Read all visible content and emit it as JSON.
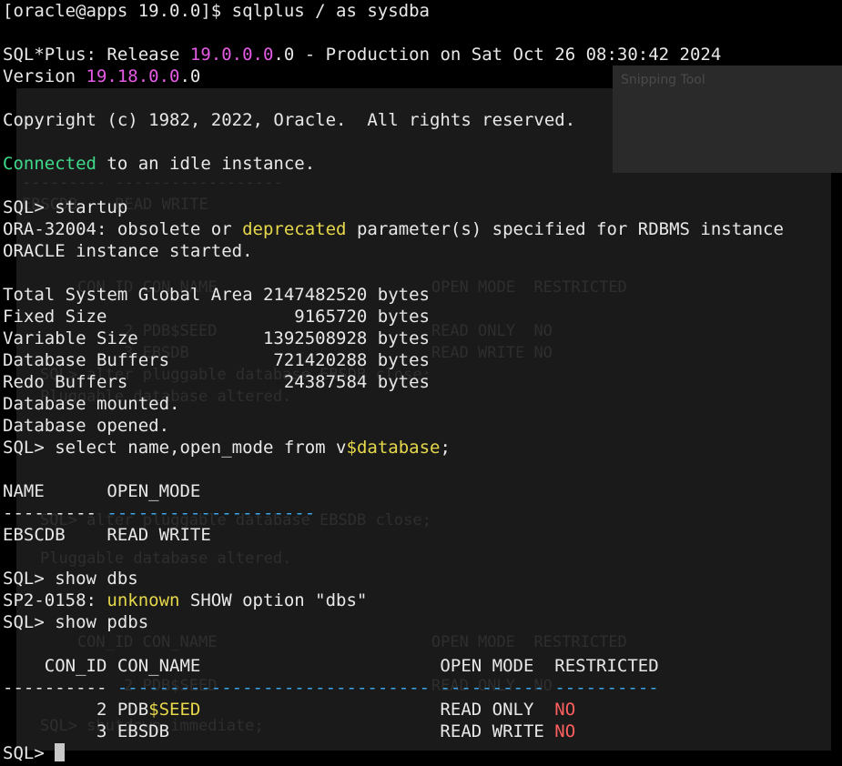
{
  "window": {
    "ghost_title": "Snipping Tool",
    "ghost_lines": [
      "--------- ------------------",
      "EBSCDB    READ WRITE",
      "    CON_ID CON_NAME                       OPEN MODE  RESTRICTED",
      "         2 PDB$SEED                       READ ONLY  NO",
      "         3 EBSDB                          READ WRITE NO",
      "SQL> alter pluggable database EBSDB close;",
      "Pluggable database altered.",
      "SQL> alter pluggable database EBSDB close;",
      "Pluggable database altered.",
      "    CON_ID CON_NAME                       OPEN MODE  RESTRICTED",
      "         2 PDB$SEED                       READ ONLY  NO",
      "SQL> shutdown immediate;"
    ]
  },
  "colors": {
    "background": "#000000",
    "text": "#e8e8e8",
    "magenta": "#e65be6",
    "green": "#3fd98a",
    "yellow": "#e6d84a",
    "red": "#ff5f5f",
    "blue": "#3aa5e8"
  },
  "lines": [
    [
      {
        "t": "[oracle@apps 19.0.0]$ sqlplus / as sysdba"
      }
    ],
    [],
    [
      {
        "t": "SQL*Plus: Release "
      },
      {
        "t": "19.0.0.0",
        "c": "magenta"
      },
      {
        "t": ".0 - Production on Sat Oct 26 08:30:42 2024"
      }
    ],
    [
      {
        "t": "Version "
      },
      {
        "t": "19.18.0.0",
        "c": "magenta"
      },
      {
        "t": ".0"
      }
    ],
    [],
    [
      {
        "t": "Copyright (c) 1982, 2022, Oracle.  All rights reserved."
      }
    ],
    [],
    [
      {
        "t": "Connected",
        "c": "green"
      },
      {
        "t": " to an idle instance."
      }
    ],
    [],
    [
      {
        "t": "SQL> startup"
      }
    ],
    [
      {
        "t": "ORA-32004: obsolete or "
      },
      {
        "t": "deprecated",
        "c": "yellow"
      },
      {
        "t": " parameter(s) specified for RDBMS instance"
      }
    ],
    [
      {
        "t": "ORACLE instance started."
      }
    ],
    [],
    [
      {
        "t": "Total System Global Area 2147482520 bytes"
      }
    ],
    [
      {
        "t": "Fixed Size                  9165720 bytes"
      }
    ],
    [
      {
        "t": "Variable Size            1392508928 bytes"
      }
    ],
    [
      {
        "t": "Database Buffers          721420288 bytes"
      }
    ],
    [
      {
        "t": "Redo Buffers               24387584 bytes"
      }
    ],
    [
      {
        "t": "Database mounted."
      }
    ],
    [
      {
        "t": "Database opened."
      }
    ],
    [
      {
        "t": "SQL> select name,open_mode from v"
      },
      {
        "t": "$database",
        "c": "yellow"
      },
      {
        "t": ";"
      }
    ],
    [],
    [
      {
        "t": "NAME      OPEN_MODE"
      }
    ],
    [
      {
        "t": "--------- "
      },
      {
        "t": "--------------------",
        "c": "blue"
      }
    ],
    [
      {
        "t": "EBSCDB    READ WRITE"
      }
    ],
    [],
    [
      {
        "t": "SQL> show dbs"
      }
    ],
    [
      {
        "t": "SP2-0158: "
      },
      {
        "t": "unknown",
        "c": "yellow"
      },
      {
        "t": " SHOW option \"dbs\""
      }
    ],
    [
      {
        "t": "SQL> show pdbs"
      }
    ],
    [],
    [
      {
        "t": "    CON_ID CON_NAME                       OPEN MODE  RESTRICTED"
      }
    ],
    [
      {
        "t": "---------- "
      },
      {
        "t": "------------------------------",
        "c": "blue"
      },
      {
        "t": " "
      },
      {
        "t": "----------",
        "c": "blue"
      },
      {
        "t": " "
      },
      {
        "t": "----------",
        "c": "blue"
      }
    ],
    [
      {
        "t": "         2 PDB"
      },
      {
        "t": "$SEED",
        "c": "yellow"
      },
      {
        "t": "                       READ ONLY  "
      },
      {
        "t": "NO",
        "c": "red"
      }
    ],
    [
      {
        "t": "         3 EBSDB                          READ WRITE "
      },
      {
        "t": "NO",
        "c": "red"
      }
    ],
    [
      {
        "t": "SQL> "
      },
      {
        "cursor": true
      }
    ]
  ]
}
